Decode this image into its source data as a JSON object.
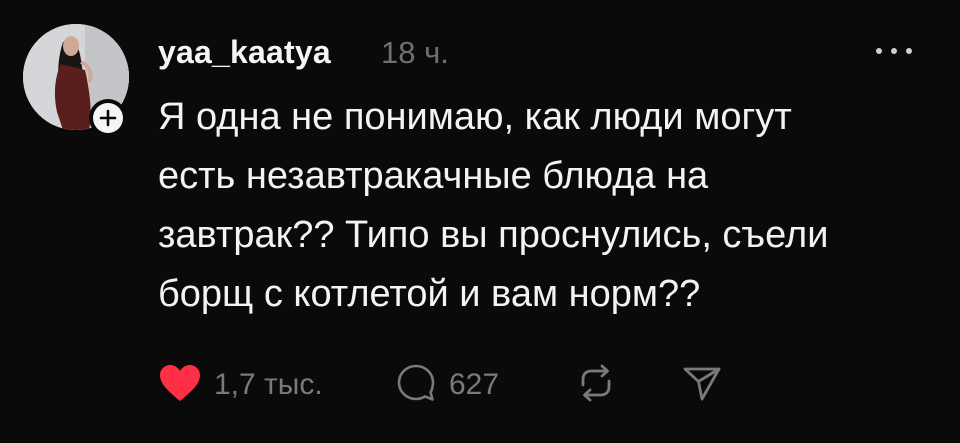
{
  "post": {
    "username": "yaa_kaatya",
    "timestamp": "18 ч.",
    "text_lines": [
      "Я одна не понимаю, как люди могут",
      "есть незавтракачные блюда на",
      "завтрак?? Типо вы проснулись, съели",
      "борщ с котлетой и вам норм??"
    ],
    "likes": "1,7 тыс.",
    "comments": "627"
  },
  "icons": {
    "like": "heart-icon",
    "comment": "comment-bubble-icon",
    "repost": "repost-icon",
    "share": "send-icon",
    "more": "more-dots-icon",
    "follow": "plus-icon"
  },
  "colors": {
    "background": "#0a0a0a",
    "text": "#f3f3f3",
    "muted": "#7a7a7a",
    "like": "#ff2f45"
  }
}
